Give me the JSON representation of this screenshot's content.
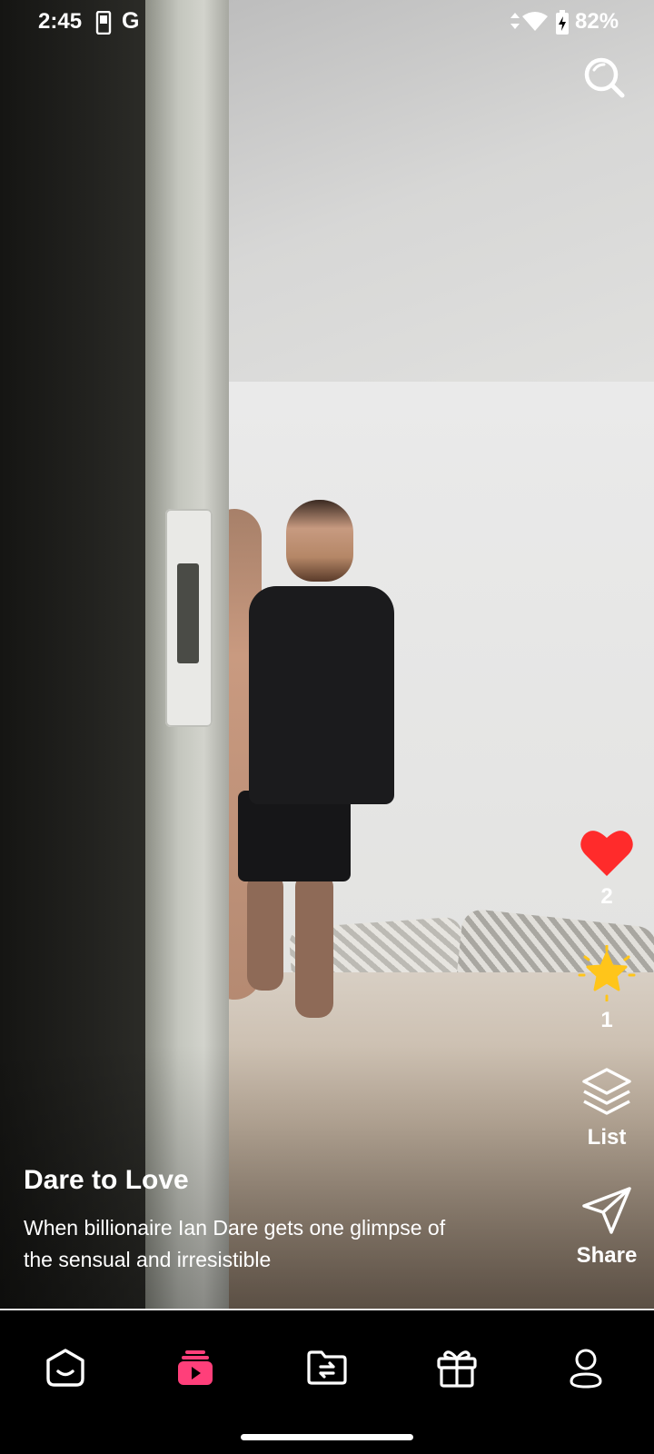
{
  "status_bar": {
    "time": "2:45",
    "carrier_glyph": "G",
    "battery_percent": "82%",
    "icons": [
      "phone-icon",
      "data-arrows-icon",
      "wifi-icon",
      "battery-charging-icon"
    ]
  },
  "header": {
    "search_icon": "search-icon"
  },
  "actions": {
    "like": {
      "icon": "heart-icon",
      "count": "2",
      "color": "#ff2b2b"
    },
    "favorite": {
      "icon": "star-icon",
      "count": "1",
      "color": "#ffc51a"
    },
    "list": {
      "icon": "layers-icon",
      "label": "List"
    },
    "share": {
      "icon": "send-icon",
      "label": "Share"
    }
  },
  "video": {
    "title": "Dare to Love",
    "description": "When billionaire Ian Dare gets one glimpse of the sensual and irresistible"
  },
  "bottom_nav": {
    "items": [
      {
        "icon": "home-icon",
        "active": false
      },
      {
        "icon": "play-stack-icon",
        "active": true,
        "color": "#ff3f7a"
      },
      {
        "icon": "folder-swap-icon",
        "active": false
      },
      {
        "icon": "gift-icon",
        "active": false
      },
      {
        "icon": "profile-icon",
        "active": false
      }
    ]
  }
}
